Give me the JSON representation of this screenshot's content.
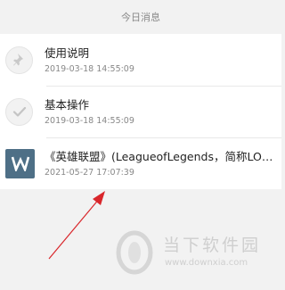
{
  "header": {
    "title": "今日消息"
  },
  "messages": [
    {
      "icon": "pin-icon",
      "title": "使用说明",
      "time": "2019-03-18 14:55:09"
    },
    {
      "icon": "checkmark-icon",
      "title": "基本操作",
      "time": "2019-03-18 14:55:09"
    },
    {
      "icon": "w-doc-icon",
      "title": "《英雄联盟》(LeagueofLegends，简称LOL)是由美国拳头游戏开发",
      "time": "2021-05-27 17:07:39"
    }
  ],
  "watermark": {
    "name": "当下软件园",
    "url": "www.downxia.com"
  },
  "colors": {
    "doc_icon_bg": "#4e6f86",
    "arrow": "#d9262b"
  }
}
